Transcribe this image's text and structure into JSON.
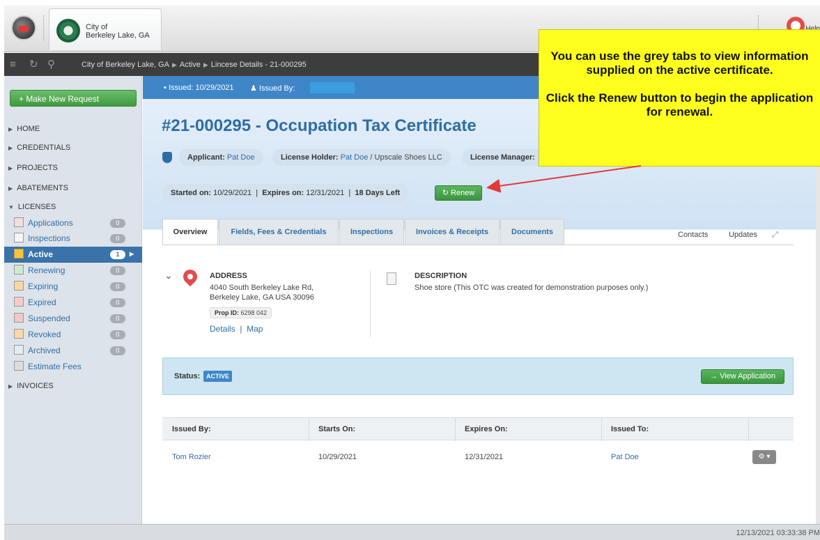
{
  "header": {
    "city_line1": "City of",
    "city_line2": "Berkeley Lake, GA",
    "help_label": "Help"
  },
  "breadcrumb": {
    "items": [
      "City of Berkeley Lake, GA",
      "Active",
      "Lincese Details - 21-000295"
    ]
  },
  "sidebar": {
    "new_request_label": "+ Make New Request",
    "sections": [
      "HOME",
      "CREDENTIALS",
      "PROJECTS",
      "ABATEMENTS",
      "LICENSES",
      "INVOICES"
    ],
    "license_items": [
      {
        "label": "Applications",
        "count": "0"
      },
      {
        "label": "Inspections",
        "count": "0"
      },
      {
        "label": "Active",
        "count": "1"
      },
      {
        "label": "Renewing",
        "count": "0"
      },
      {
        "label": "Expiring",
        "count": "0"
      },
      {
        "label": "Expired",
        "count": "0"
      },
      {
        "label": "Suspended",
        "count": "0"
      },
      {
        "label": "Revoked",
        "count": "0"
      },
      {
        "label": "Archived",
        "count": "0"
      },
      {
        "label": "Estimate Fees",
        "count": ""
      }
    ]
  },
  "issued_bar": {
    "issued": "Issued: 10/29/2021",
    "issued_by": "Issued By:"
  },
  "main": {
    "title": "#21-000295 - Occupation Tax Certificate",
    "applicant_label": "Applicant:",
    "applicant_value": "Pat Doe",
    "holder_label": "License Holder:",
    "holder_value": "Pat Doe",
    "holder_suffix": " / Upscale Shoes LLC",
    "manager_label": "License Manager:",
    "started_label": "Started on:",
    "started_value": "10/29/2021",
    "expires_label": "Expires on:",
    "expires_value": "12/31/2021",
    "days_left": "18 Days Left",
    "renew_label": "Renew",
    "tabs": [
      "Overview",
      "Fields, Fees & Credentials",
      "Inspections",
      "Invoices & Receipts",
      "Documents"
    ],
    "contacts_label": "Contacts",
    "updates_label": "Updates",
    "address_heading": "ADDRESS",
    "address_line1": "4040 South Berkeley Lake Rd,",
    "address_line2": "Berkeley Lake, GA USA 30096",
    "prop_id_label": "Prop ID:",
    "prop_id_value": "6298 042",
    "details_link": "Details",
    "map_link": "Map",
    "description_heading": "DESCRIPTION",
    "description_text": "Shoe store (This OTC was created for demonstration purposes only.)",
    "status_label": "Status:",
    "status_value": "ACTIVE",
    "view_app_label": "View Application"
  },
  "table": {
    "headers": [
      "Issued By:",
      "Starts On:",
      "Expires On:",
      "Issued To:"
    ],
    "row": {
      "issued_by": "Tom Rozier",
      "starts_on": "10/29/2021",
      "expires_on": "12/31/2021",
      "issued_to": "Pat Doe"
    }
  },
  "callout": {
    "line1": "You can use the grey tabs to view information supplied on the active certificate.",
    "line2": "Click the Renew button to begin the application for renewal."
  },
  "footer": {
    "timestamp": "12/13/2021 03:33:38 PM"
  },
  "colors": {
    "accent_blue": "#3f86c8",
    "green_button": "#3c963f",
    "callout_yellow": "#ffff1e",
    "arrow_red": "#e03a3a"
  }
}
